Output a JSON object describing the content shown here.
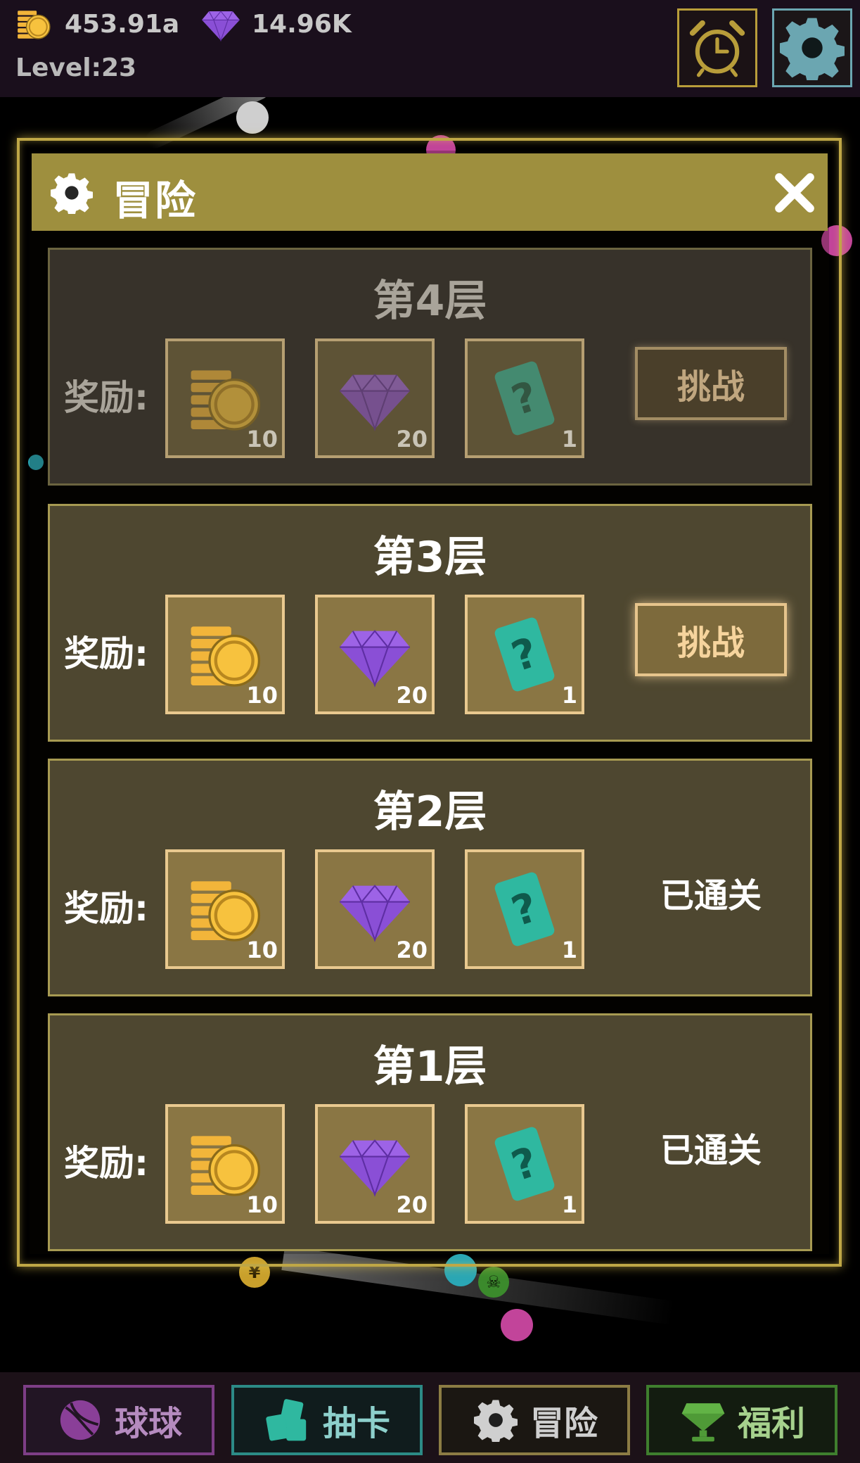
{
  "hud": {
    "coins": "453.91a",
    "gems": "14.96K",
    "level": "Level:23",
    "coin_icon": "coin-stack-icon",
    "gem_icon": "diamond-icon",
    "alarm_icon": "alarm-clock-icon",
    "settings_icon": "gear-icon"
  },
  "dialog": {
    "title": "冒险",
    "title_icon": "gear-icon",
    "close_icon": "close-icon"
  },
  "layers": [
    {
      "title": "第4层",
      "reward_label": "奖励:",
      "rewards": [
        {
          "icon": "coin-stack-icon",
          "count": "10"
        },
        {
          "icon": "diamond-icon",
          "count": "20"
        },
        {
          "icon": "mystery-card-icon",
          "count": "1"
        }
      ],
      "state": "locked",
      "action_label": "挑战"
    },
    {
      "title": "第3层",
      "reward_label": "奖励:",
      "rewards": [
        {
          "icon": "coin-stack-icon",
          "count": "10"
        },
        {
          "icon": "diamond-icon",
          "count": "20"
        },
        {
          "icon": "mystery-card-icon",
          "count": "1"
        }
      ],
      "state": "available",
      "action_label": "挑战"
    },
    {
      "title": "第2层",
      "reward_label": "奖励:",
      "rewards": [
        {
          "icon": "coin-stack-icon",
          "count": "10"
        },
        {
          "icon": "diamond-icon",
          "count": "20"
        },
        {
          "icon": "mystery-card-icon",
          "count": "1"
        }
      ],
      "state": "cleared",
      "status_label": "已通关"
    },
    {
      "title": "第1层",
      "reward_label": "奖励:",
      "rewards": [
        {
          "icon": "coin-stack-icon",
          "count": "10"
        },
        {
          "icon": "diamond-icon",
          "count": "20"
        },
        {
          "icon": "mystery-card-icon",
          "count": "1"
        }
      ],
      "state": "cleared",
      "status_label": "已通关"
    }
  ],
  "nav": {
    "balls_label": "球球",
    "draw_label": "抽卡",
    "adventure_label": "冒险",
    "welfare_label": "福利"
  },
  "colors": {
    "coin": "#f2b53a",
    "gem": "#8a4fd6",
    "card": "#2fb8a0",
    "gold_frame": "#bfa746"
  }
}
